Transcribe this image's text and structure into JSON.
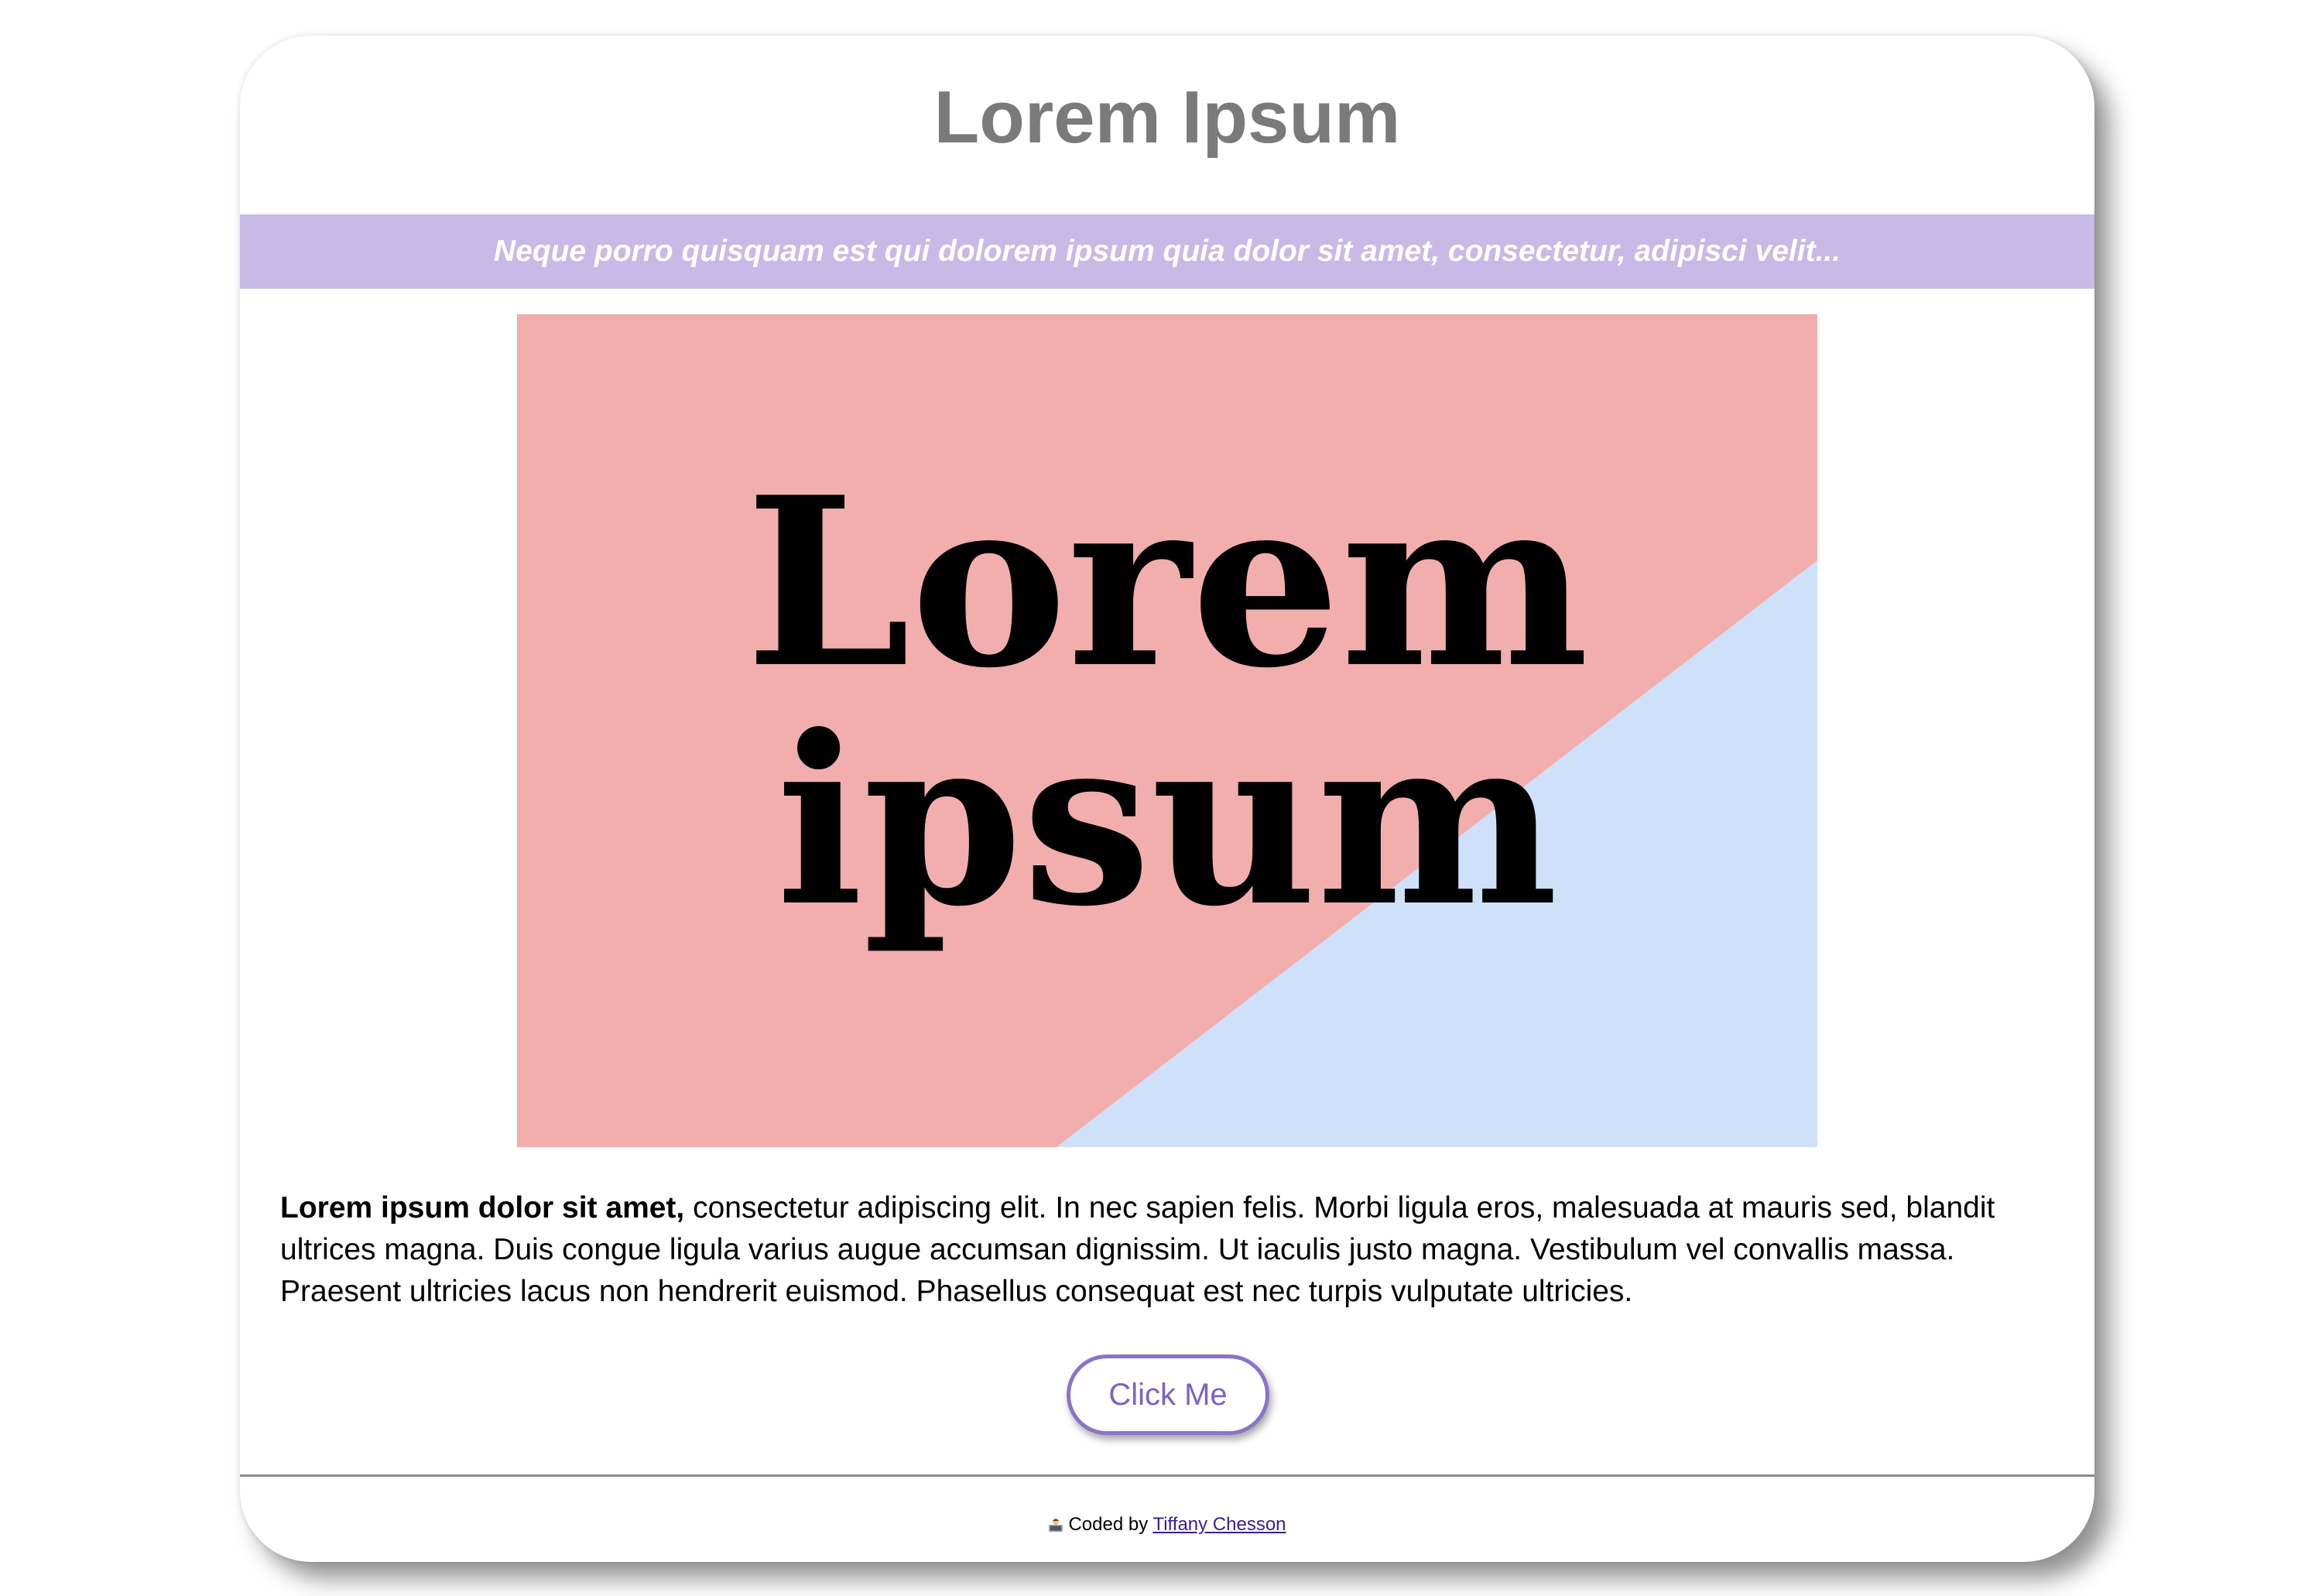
{
  "header": {
    "title": "Lorem Ipsum"
  },
  "banner": {
    "text": "Neque porro quisquam est qui dolorem ipsum quia dolor sit amet, consectetur, adipisci velit..."
  },
  "hero_image": {
    "line1": "Lorem",
    "line2": "ipsum",
    "colors": {
      "pink": "#f2aeac",
      "blue": "#cfe1fa"
    }
  },
  "content": {
    "lead_bold": "Lorem ipsum dolor sit amet,",
    "paragraph": " consectetur adipiscing elit. In nec sapien felis. Morbi ligula eros, malesuada at mauris sed, blandit ultrices magna. Duis congue ligula varius augue accumsan dignissim. Ut iaculis justo magna. Vestibulum vel convallis massa. Praesent ultricies lacus non hendrerit euismod. Phasellus consequat est nec turpis vulputate ultricies."
  },
  "button": {
    "label": "Click Me"
  },
  "footer": {
    "icon": "coder-emoji-icon",
    "prefix": "Coded by",
    "link_text": "Tiffany Chesson"
  },
  "colors": {
    "banner": "#c9b9e6",
    "title": "#7a7a7a",
    "accent": "#8a74c7"
  }
}
